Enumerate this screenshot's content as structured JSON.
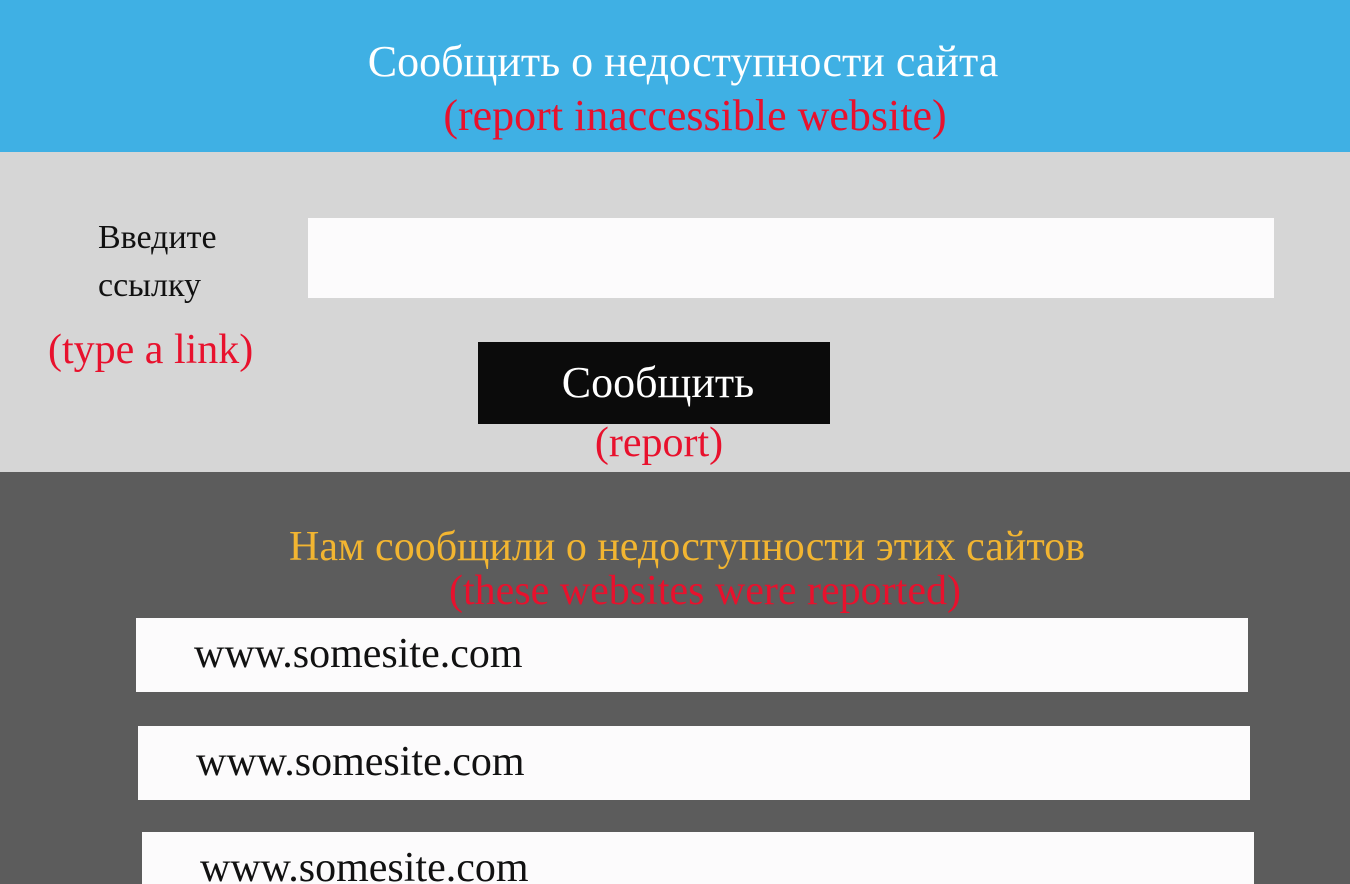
{
  "header": {
    "title": "Сообщить о недоступности сайта",
    "subtitle": "(report inaccessible website)"
  },
  "form": {
    "label": "Введите ссылку",
    "label_note": "(type a link)",
    "input_value": "",
    "input_placeholder": "",
    "button_label": "Сообщить",
    "button_note": "(report)"
  },
  "reported": {
    "title": "Нам сообщили о недоступности этих сайтов",
    "subtitle": "(these websites were reported)",
    "sites": [
      "www.somesite.com",
      "www.somesite.com",
      "www.somesite.com"
    ]
  },
  "colors": {
    "header_bg": "#3fb0e4",
    "form_bg": "#d6d6d6",
    "reported_bg": "#5c5c5c",
    "annotation": "#e8112d",
    "reported_title": "#f2b531",
    "button_bg": "#0b0b0b"
  }
}
